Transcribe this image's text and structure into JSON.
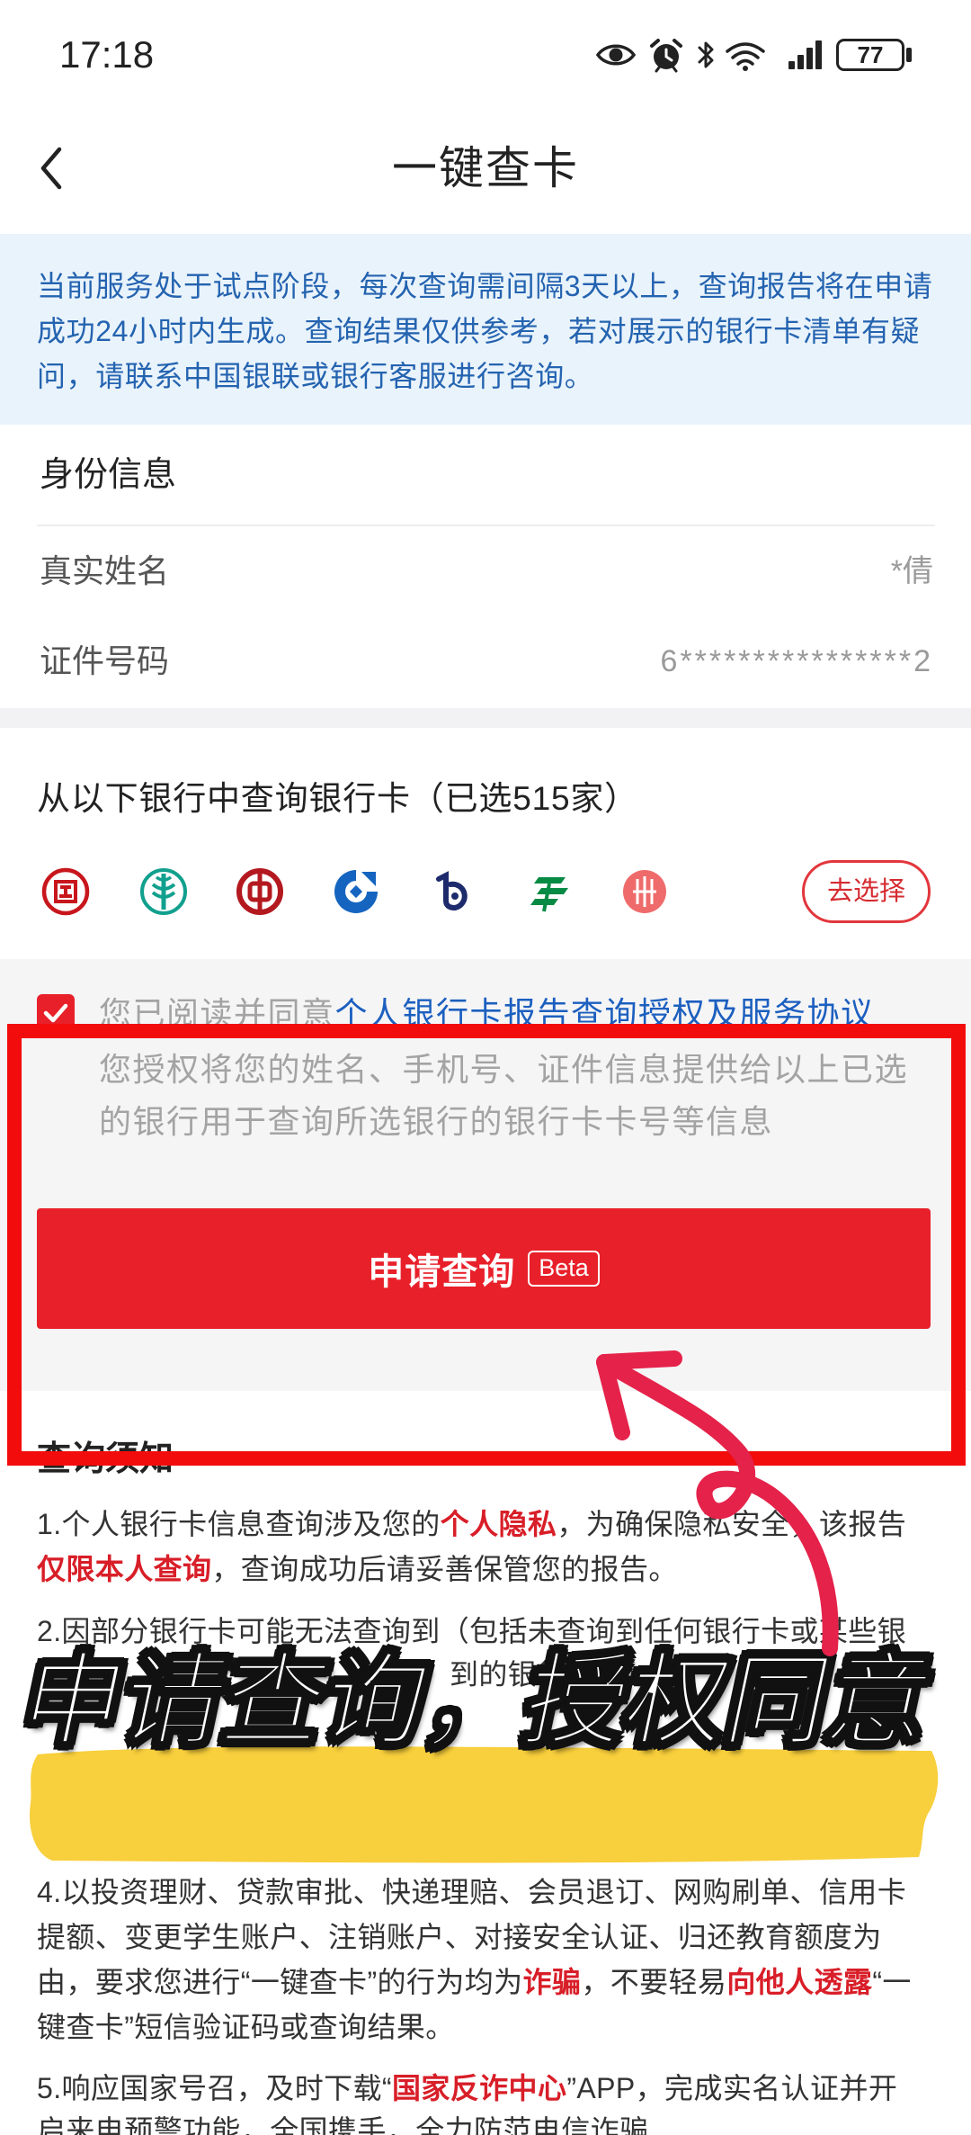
{
  "status_bar": {
    "time": "17:18",
    "battery_level": "77",
    "icons": [
      "eye-icon",
      "alarm-icon",
      "bluetooth-icon",
      "wifi-icon",
      "signal-icon",
      "battery-icon"
    ]
  },
  "nav": {
    "back_icon": "chevron-left-icon",
    "title": "一键查卡"
  },
  "notice": {
    "lines": [
      "当前服务处于试点阶段，每次查询需间隔3天以上，查询报告将在申请",
      "成功24小时内生成。查询结果仅供参考，若对展示的银行卡清单有疑",
      "问，请联系中国银联或银行客服进行咨询。"
    ]
  },
  "identity": {
    "title": "身份信息",
    "fields": [
      {
        "label": "真实姓名",
        "value": "*倩"
      },
      {
        "label": "证件号码",
        "value": "6****************2"
      }
    ]
  },
  "banks": {
    "title": "从以下银行中查询银行卡（已选515家）",
    "logos": [
      "icbc-logo-icon",
      "abc-logo-icon",
      "boc-logo-icon",
      "ccb-logo-icon",
      "bocom-logo-icon",
      "psbc-logo-icon",
      "citic-logo-icon"
    ],
    "choose_button": "去选择"
  },
  "agreement": {
    "checked": true,
    "prefix": "您已阅读并同意",
    "link": "个人银行卡报告查询授权及服务协议",
    "desc_lines": [
      "您授权将您的姓名、手机号、证件信息提供给以上已选",
      "的银行用于查询所选银行的银行卡卡号等信息"
    ]
  },
  "submit": {
    "label": "申请查询",
    "badge": "Beta"
  },
  "notes": {
    "title": "查询须知",
    "lines": [
      [
        {
          "text": "1.个人银行卡信息查询涉及您的"
        },
        {
          "text": "个人隐私",
          "emphasis": true
        },
        {
          "text": "，为确保隐私安全，该报告"
        }
      ],
      [
        {
          "text": "仅限本人查询",
          "emphasis": true
        },
        {
          "text": "，查询成功后请妥善保管您的报告。"
        }
      ],
      [
        {
          "text": "2.因部分银行卡可能无法查询到（包括未查询到任何银行卡或某些银"
        }
      ],
      [
        {
          "text": "到的银行"
        }
      ],
      [
        {
          "text": "4.以投资理财、贷款审批、快递理赔、会员退订、网购刷单、信用卡"
        }
      ],
      [
        {
          "text": "提额、变更学生账户、注销账户、对接安全认证、归还教育额度为"
        }
      ],
      [
        {
          "text": "由，要求您进行“一键查卡”的行为均为"
        },
        {
          "text": "诈骗",
          "emphasis": true
        },
        {
          "text": "，不要轻易"
        },
        {
          "text": "向他人透露",
          "emphasis": true
        },
        {
          "text": "“一"
        }
      ],
      [
        {
          "text": "键查卡”短信验证码或查询结果。"
        }
      ],
      [
        {
          "text": "5.响应国家号召，及时下载“"
        },
        {
          "text": "国家反诈中心",
          "emphasis": true
        },
        {
          "text": "”APP，完成实名认证并开"
        }
      ],
      [
        {
          "text": "启来电预警功能，全国携手，全力防范电信诈骗"
        }
      ]
    ]
  },
  "annotation": {
    "caption": "申请查询，授权同意"
  },
  "colors": {
    "accent_red": "#e8202a",
    "notice_text_blue": "#2463b0",
    "notice_bg": "#e9f3fb",
    "emphasis_red": "#d81e28",
    "link_blue": "#1c5fbf",
    "annotation_red": "#f20c0c",
    "arrow_red": "#e5224a",
    "highlight_yellow": "#f8cf3c"
  }
}
